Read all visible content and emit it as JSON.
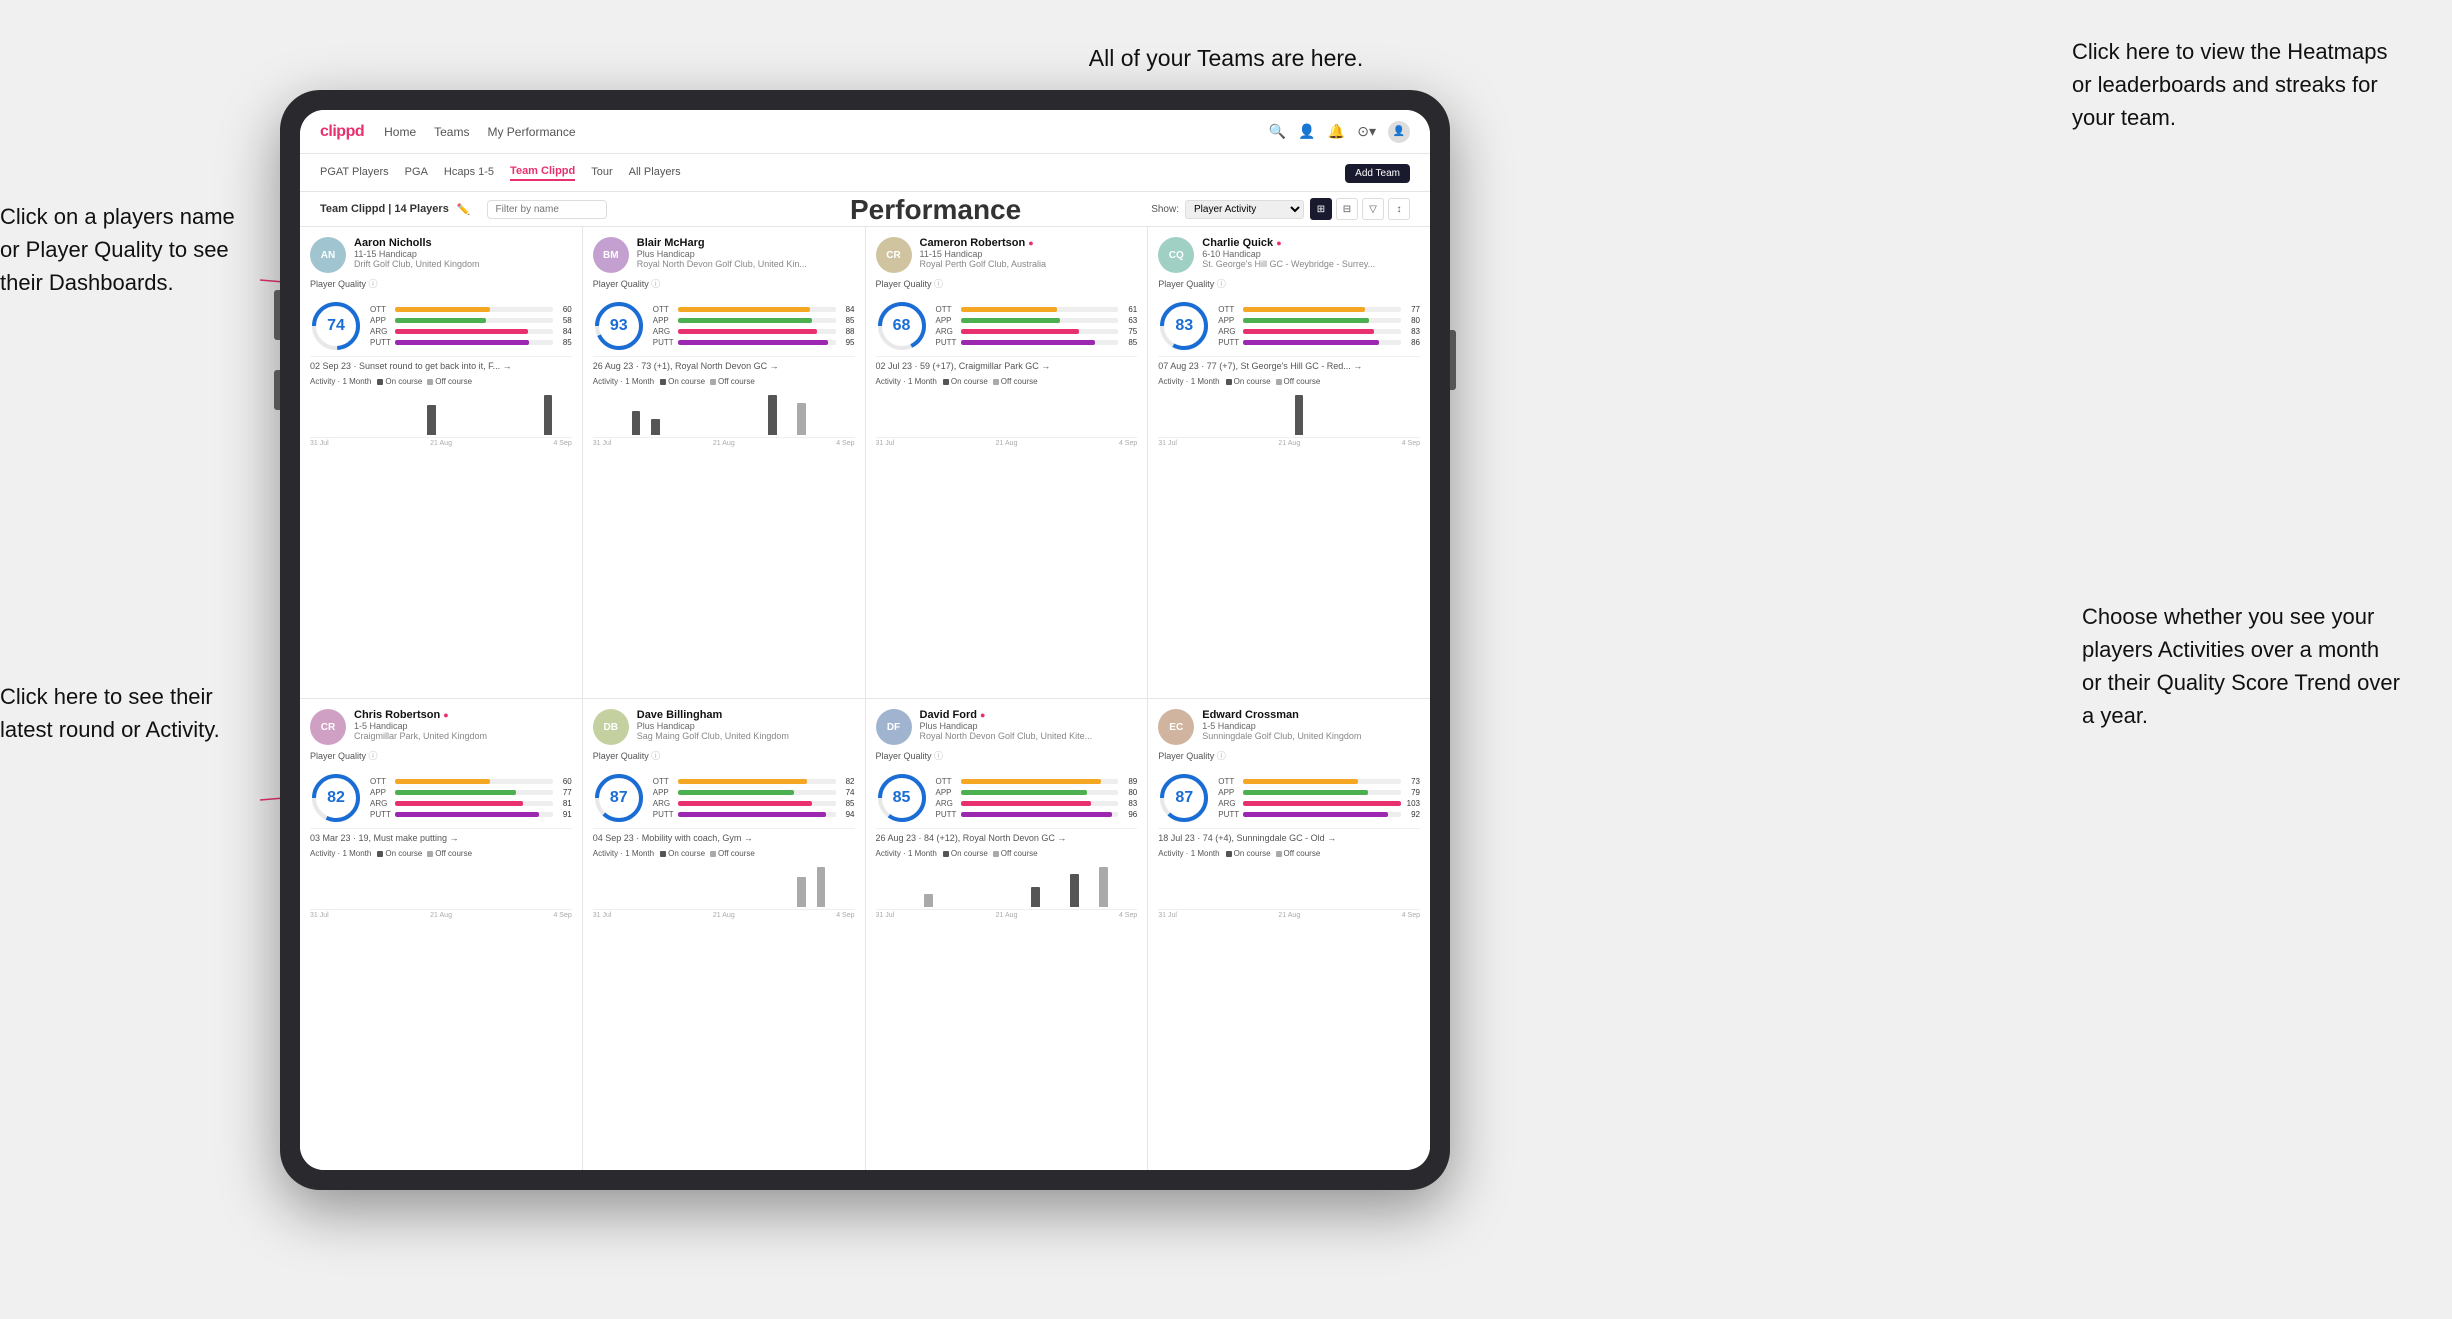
{
  "annotations": {
    "top_center": "All of your Teams are here.",
    "top_right": "Click here to view the\nHeatmaps or leaderboards\nand streaks for your team.",
    "left_top": "Click on a players name\nor Player Quality to see\ntheir Dashboards.",
    "left_bottom": "Click here to see their latest\nround or Activity.",
    "right_bottom": "Choose whether you see\nyour players Activities over\na month or their Quality\nScore Trend over a year.",
    "performance": "Performance"
  },
  "navbar": {
    "logo": "clippd",
    "links": [
      "Home",
      "Teams",
      "My Performance"
    ],
    "icons": [
      "🔍",
      "👤",
      "🔔",
      "⊙",
      "👤"
    ]
  },
  "subnav": {
    "tabs": [
      "PGAT Players",
      "PGA",
      "Hcaps 1-5",
      "Team Clippd",
      "Tour",
      "All Players"
    ],
    "active": "Team Clippd",
    "add_button": "Add Team"
  },
  "toolbar": {
    "title": "Team Clippd | 14 Players",
    "search_placeholder": "Filter by name",
    "show_label": "Show:",
    "show_option": "Player Activity",
    "view_modes": [
      "grid-2x2",
      "grid-3x3",
      "filter",
      "sort"
    ]
  },
  "players": [
    {
      "name": "Aaron Nicholls",
      "handicap": "11-15 Handicap",
      "club": "Drift Golf Club, United Kingdom",
      "quality": 74,
      "ott": {
        "value": 60,
        "pct": 60
      },
      "app": {
        "value": 58,
        "pct": 58
      },
      "arg": {
        "value": 84,
        "pct": 84
      },
      "putt": {
        "value": 85,
        "pct": 85
      },
      "latest_round": "02 Sep 23 · Sunset round to get back into it, F... →",
      "activity_label": "Activity · 1 Month",
      "chart_bars": [
        0,
        0,
        0,
        0,
        0,
        0,
        0,
        0,
        0,
        0,
        0,
        0,
        3,
        0,
        0,
        0,
        0,
        0,
        0,
        0,
        0,
        0,
        0,
        0,
        4,
        0,
        0
      ],
      "chart_dates": [
        "31 Jul",
        "21 Aug",
        "4 Sep"
      ]
    },
    {
      "name": "Blair McHarg",
      "handicap": "Plus Handicap",
      "club": "Royal North Devon Golf Club, United Kin...",
      "quality": 93,
      "ott": {
        "value": 84,
        "pct": 84
      },
      "app": {
        "value": 85,
        "pct": 85
      },
      "arg": {
        "value": 88,
        "pct": 88
      },
      "putt": {
        "value": 95,
        "pct": 95
      },
      "latest_round": "26 Aug 23 · 73 (+1), Royal North Devon GC →",
      "activity_label": "Activity · 1 Month",
      "chart_bars": [
        0,
        0,
        0,
        0,
        3,
        0,
        2,
        0,
        0,
        0,
        0,
        0,
        0,
        0,
        0,
        0,
        0,
        0,
        5,
        0,
        0,
        4,
        0,
        0,
        0,
        0,
        0
      ],
      "chart_dates": [
        "31 Jul",
        "21 Aug",
        "4 Sep"
      ]
    },
    {
      "name": "Cameron Robertson",
      "handicap": "11-15 Handicap",
      "club": "Royal Perth Golf Club, Australia",
      "quality": 68,
      "ott": {
        "value": 61,
        "pct": 61
      },
      "app": {
        "value": 63,
        "pct": 63
      },
      "arg": {
        "value": 75,
        "pct": 75
      },
      "putt": {
        "value": 85,
        "pct": 85
      },
      "latest_round": "02 Jul 23 · 59 (+17), Craigmillar Park GC →",
      "activity_label": "Activity · 1 Month",
      "chart_bars": [
        0,
        0,
        0,
        0,
        0,
        0,
        0,
        0,
        0,
        0,
        0,
        0,
        0,
        0,
        0,
        0,
        0,
        0,
        0,
        0,
        0,
        0,
        0,
        0,
        0,
        0,
        0
      ],
      "chart_dates": [
        "31 Jul",
        "21 Aug",
        "4 Sep"
      ]
    },
    {
      "name": "Charlie Quick",
      "handicap": "6-10 Handicap",
      "club": "St. George's Hill GC - Weybridge - Surrey...",
      "quality": 83,
      "ott": {
        "value": 77,
        "pct": 77
      },
      "app": {
        "value": 80,
        "pct": 80
      },
      "arg": {
        "value": 83,
        "pct": 83
      },
      "putt": {
        "value": 86,
        "pct": 86
      },
      "latest_round": "07 Aug 23 · 77 (+7), St George's Hill GC - Red... →",
      "activity_label": "Activity · 1 Month",
      "chart_bars": [
        0,
        0,
        0,
        0,
        0,
        0,
        0,
        0,
        0,
        0,
        0,
        0,
        0,
        0,
        3,
        0,
        0,
        0,
        0,
        0,
        0,
        0,
        0,
        0,
        0,
        0,
        0
      ],
      "chart_dates": [
        "31 Jul",
        "21 Aug",
        "4 Sep"
      ]
    },
    {
      "name": "Chris Robertson",
      "handicap": "1-5 Handicap",
      "club": "Craigmillar Park, United Kingdom",
      "quality": 82,
      "ott": {
        "value": 60,
        "pct": 60
      },
      "app": {
        "value": 77,
        "pct": 77
      },
      "arg": {
        "value": 81,
        "pct": 81
      },
      "putt": {
        "value": 91,
        "pct": 91
      },
      "latest_round": "03 Mar 23 · 19, Must make putting →",
      "activity_label": "Activity · 1 Month",
      "chart_bars": [
        0,
        0,
        0,
        0,
        0,
        0,
        0,
        0,
        0,
        0,
        0,
        0,
        0,
        0,
        0,
        0,
        0,
        0,
        0,
        0,
        0,
        0,
        0,
        0,
        0,
        0,
        0
      ],
      "chart_dates": [
        "31 Jul",
        "21 Aug",
        "4 Sep"
      ]
    },
    {
      "name": "Dave Billingham",
      "handicap": "Plus Handicap",
      "club": "Sag Maing Golf Club, United Kingdom",
      "quality": 87,
      "ott": {
        "value": 82,
        "pct": 82
      },
      "app": {
        "value": 74,
        "pct": 74
      },
      "arg": {
        "value": 85,
        "pct": 85
      },
      "putt": {
        "value": 94,
        "pct": 94
      },
      "latest_round": "04 Sep 23 · Mobility with coach, Gym →",
      "activity_label": "Activity · 1 Month",
      "chart_bars": [
        0,
        0,
        0,
        0,
        0,
        0,
        0,
        0,
        0,
        0,
        0,
        0,
        0,
        0,
        0,
        0,
        0,
        0,
        0,
        0,
        0,
        3,
        0,
        4,
        0,
        0,
        0
      ],
      "chart_dates": [
        "31 Jul",
        "21 Aug",
        "4 Sep"
      ]
    },
    {
      "name": "David Ford",
      "handicap": "Plus Handicap",
      "club": "Royal North Devon Golf Club, United Kite...",
      "quality": 85,
      "ott": {
        "value": 89,
        "pct": 89
      },
      "app": {
        "value": 80,
        "pct": 80
      },
      "arg": {
        "value": 83,
        "pct": 83
      },
      "putt": {
        "value": 96,
        "pct": 96
      },
      "latest_round": "26 Aug 23 · 84 (+12), Royal North Devon GC →",
      "activity_label": "Activity · 1 Month",
      "chart_bars": [
        0,
        0,
        0,
        0,
        0,
        2,
        0,
        0,
        0,
        0,
        0,
        0,
        0,
        0,
        0,
        0,
        3,
        0,
        0,
        0,
        5,
        0,
        0,
        6,
        0,
        0,
        0
      ],
      "chart_dates": [
        "31 Jul",
        "21 Aug",
        "4 Sep"
      ]
    },
    {
      "name": "Edward Crossman",
      "handicap": "1-5 Handicap",
      "club": "Sunningdale Golf Club, United Kingdom",
      "quality": 87,
      "ott": {
        "value": 73,
        "pct": 73
      },
      "app": {
        "value": 79,
        "pct": 79
      },
      "arg": {
        "value": 103,
        "pct": 100
      },
      "putt": {
        "value": 92,
        "pct": 92
      },
      "latest_round": "18 Jul 23 · 74 (+4), Sunningdale GC - Old →",
      "activity_label": "Activity · 1 Month",
      "chart_bars": [
        0,
        0,
        0,
        0,
        0,
        0,
        0,
        0,
        0,
        0,
        0,
        0,
        0,
        0,
        0,
        0,
        0,
        0,
        0,
        0,
        0,
        0,
        0,
        0,
        0,
        0,
        0
      ],
      "chart_dates": [
        "31 Jul",
        "21 Aug",
        "4 Sep"
      ]
    }
  ],
  "avatar_colors": [
    "#a0c4d0",
    "#c4a0d0",
    "#d0c4a0",
    "#a0d0c4",
    "#d0a0c4",
    "#c4d0a0",
    "#a0b4d0",
    "#d0b4a0"
  ],
  "avatar_initials": [
    "AN",
    "BM",
    "CR",
    "CQ",
    "CR",
    "DB",
    "DF",
    "EC"
  ]
}
